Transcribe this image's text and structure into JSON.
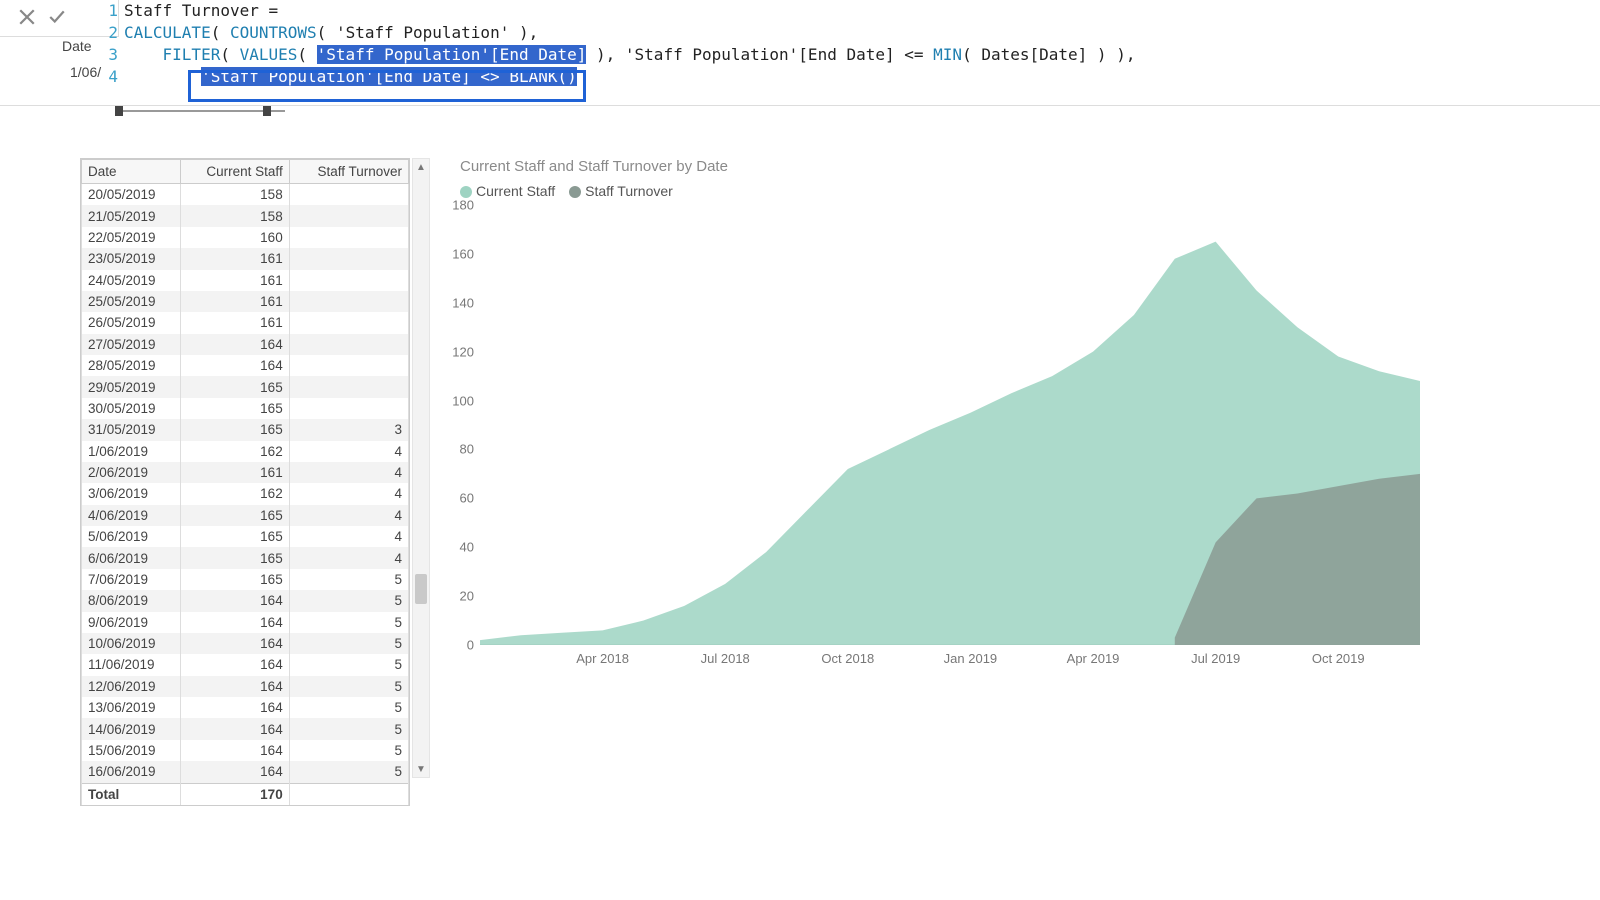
{
  "formula": {
    "behind_date_label": "Date",
    "behind_cell_value": "1/06/",
    "lines": {
      "l1_name": "Staff Turnover",
      "l1_eq": " = ",
      "l2_calc": "CALCULATE",
      "l2_paren1": "( ",
      "l2_countrows": "COUNTROWS",
      "l2_rest": "( 'Staff Population' ),",
      "l3_indent": "    ",
      "l3_filter": "FILTER",
      "l3_p1": "( ",
      "l3_values": "VALUES",
      "l3_p2": "( ",
      "l3_sel": "'Staff Population'[End Date]",
      "l3_p3": " ), 'Staff Population'[End Date] <= ",
      "l3_min": "MIN",
      "l3_p4": "( Dates[Date] ) ),",
      "l4_indent": "        ",
      "l4_sel_a": "'Staff Population'[End Date] <> ",
      "l4_blank": "BLANK",
      "l4_sel_b": "()"
    }
  },
  "table": {
    "headers": [
      "Date",
      "Current Staff",
      "Staff Turnover"
    ],
    "rows": [
      {
        "d": "20/05/2019",
        "c": "158",
        "t": ""
      },
      {
        "d": "21/05/2019",
        "c": "158",
        "t": ""
      },
      {
        "d": "22/05/2019",
        "c": "160",
        "t": ""
      },
      {
        "d": "23/05/2019",
        "c": "161",
        "t": ""
      },
      {
        "d": "24/05/2019",
        "c": "161",
        "t": ""
      },
      {
        "d": "25/05/2019",
        "c": "161",
        "t": ""
      },
      {
        "d": "26/05/2019",
        "c": "161",
        "t": ""
      },
      {
        "d": "27/05/2019",
        "c": "164",
        "t": ""
      },
      {
        "d": "28/05/2019",
        "c": "164",
        "t": ""
      },
      {
        "d": "29/05/2019",
        "c": "165",
        "t": ""
      },
      {
        "d": "30/05/2019",
        "c": "165",
        "t": ""
      },
      {
        "d": "31/05/2019",
        "c": "165",
        "t": "3"
      },
      {
        "d": "1/06/2019",
        "c": "162",
        "t": "4"
      },
      {
        "d": "2/06/2019",
        "c": "161",
        "t": "4"
      },
      {
        "d": "3/06/2019",
        "c": "162",
        "t": "4"
      },
      {
        "d": "4/06/2019",
        "c": "165",
        "t": "4"
      },
      {
        "d": "5/06/2019",
        "c": "165",
        "t": "4"
      },
      {
        "d": "6/06/2019",
        "c": "165",
        "t": "4"
      },
      {
        "d": "7/06/2019",
        "c": "165",
        "t": "5"
      },
      {
        "d": "8/06/2019",
        "c": "164",
        "t": "5"
      },
      {
        "d": "9/06/2019",
        "c": "164",
        "t": "5"
      },
      {
        "d": "10/06/2019",
        "c": "164",
        "t": "5"
      },
      {
        "d": "11/06/2019",
        "c": "164",
        "t": "5"
      },
      {
        "d": "12/06/2019",
        "c": "164",
        "t": "5"
      },
      {
        "d": "13/06/2019",
        "c": "164",
        "t": "5"
      },
      {
        "d": "14/06/2019",
        "c": "164",
        "t": "5"
      },
      {
        "d": "15/06/2019",
        "c": "164",
        "t": "5"
      },
      {
        "d": "16/06/2019",
        "c": "164",
        "t": "5"
      }
    ],
    "footer": {
      "label": "Total",
      "c": "170",
      "t": ""
    }
  },
  "chart_data": {
    "type": "area",
    "title": "Current Staff and Staff Turnover by Date",
    "legend": [
      "Current Staff",
      "Staff Turnover"
    ],
    "colors": {
      "current": "#9ed3c2",
      "turnover": "#8a9a93"
    },
    "ylabel": "",
    "xlabel": "",
    "ylim": [
      0,
      180
    ],
    "yticks": [
      0,
      20,
      40,
      60,
      80,
      100,
      120,
      140,
      160,
      180
    ],
    "xticks": [
      "Apr 2018",
      "Jul 2018",
      "Oct 2018",
      "Jan 2019",
      "Apr 2019",
      "Jul 2019",
      "Oct 2019"
    ],
    "x_months": [
      "Jan 2018",
      "Feb 2018",
      "Mar 2018",
      "Apr 2018",
      "May 2018",
      "Jun 2018",
      "Jul 2018",
      "Aug 2018",
      "Sep 2018",
      "Oct 2018",
      "Nov 2018",
      "Dec 2018",
      "Jan 2019",
      "Feb 2019",
      "Mar 2019",
      "Apr 2019",
      "May 2019",
      "Jun 2019",
      "Jul 2019",
      "Aug 2019",
      "Sep 2019",
      "Oct 2019",
      "Nov 2019",
      "Dec 2019"
    ],
    "series": [
      {
        "name": "Current Staff",
        "values": [
          2,
          4,
          5,
          6,
          10,
          16,
          25,
          38,
          55,
          72,
          80,
          88,
          95,
          103,
          110,
          120,
          135,
          158,
          165,
          145,
          130,
          118,
          112,
          108
        ]
      },
      {
        "name": "Staff Turnover",
        "values": [
          null,
          null,
          null,
          null,
          null,
          null,
          null,
          null,
          null,
          null,
          null,
          null,
          null,
          null,
          null,
          null,
          null,
          3,
          42,
          60,
          62,
          65,
          68,
          70
        ]
      }
    ]
  }
}
